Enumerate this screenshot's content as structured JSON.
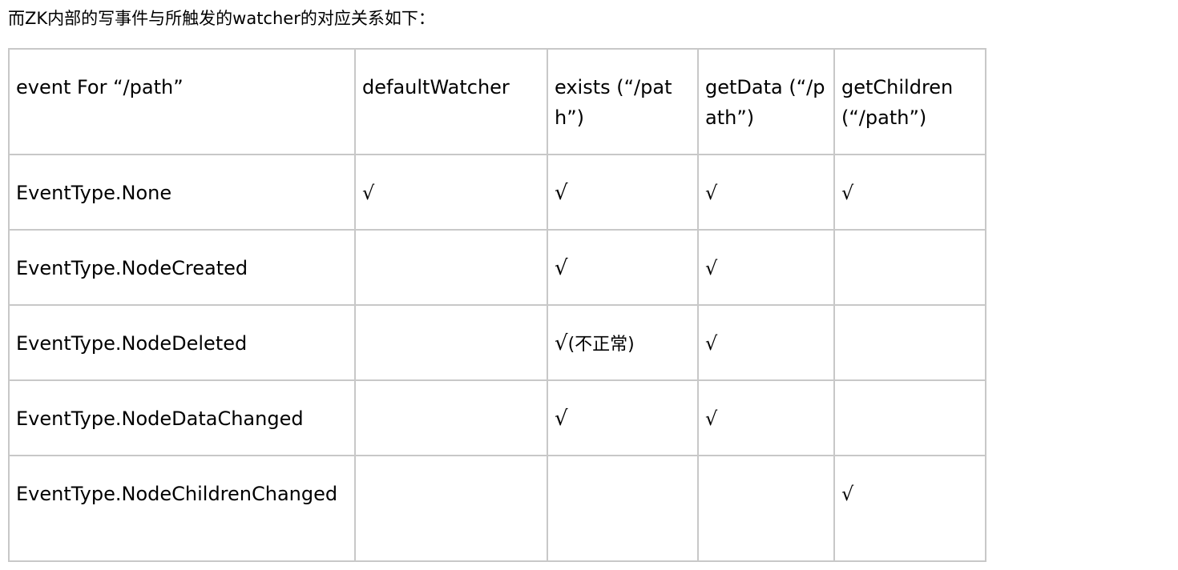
{
  "intro": "而ZK内部的写事件与所触发的watcher的对应关系如下：",
  "table": {
    "headers": [
      "event For “/path”",
      "defaultWatcher",
      "exists (“/path”)",
      "getData (“/path”)",
      "getChildren (“/path”)"
    ],
    "rows": [
      {
        "event": "EventType.None",
        "default": "√",
        "exists": "√",
        "exists_note": "",
        "getdata": "√",
        "getchildren": "√"
      },
      {
        "event": "EventType.NodeCreated",
        "default": "",
        "exists": "√",
        "exists_note": "",
        "getdata": "√",
        "getchildren": ""
      },
      {
        "event": "EventType.NodeDeleted",
        "default": "",
        "exists": "√",
        "exists_note": "(不正常)",
        "getdata": "√",
        "getchildren": ""
      },
      {
        "event": "EventType.NodeDataChanged",
        "default": "",
        "exists": "√",
        "exists_note": "",
        "getdata": "√",
        "getchildren": ""
      },
      {
        "event": "EventType.NodeChildrenChanged",
        "default": "",
        "exists": "",
        "exists_note": "",
        "getdata": "",
        "getchildren": "√"
      }
    ]
  }
}
